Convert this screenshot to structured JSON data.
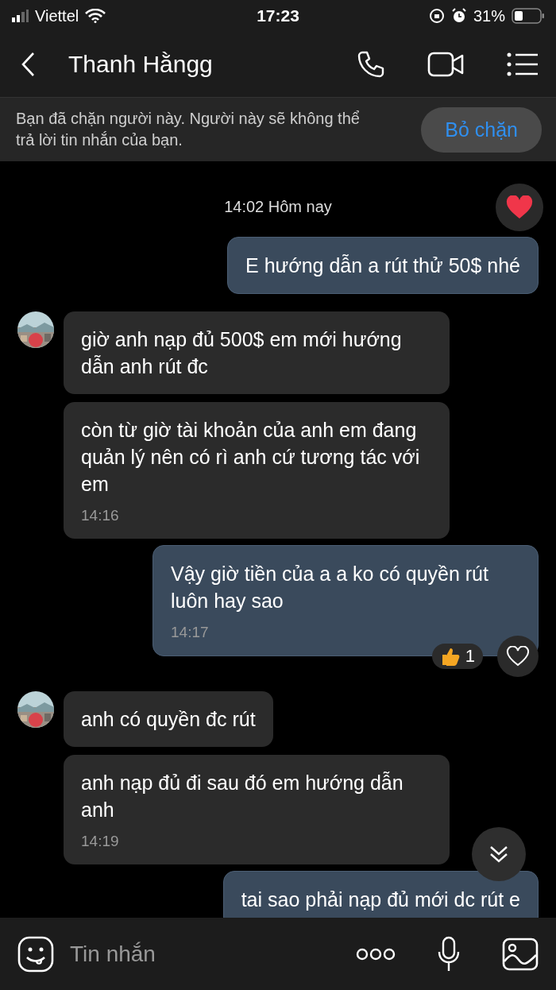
{
  "status_bar": {
    "carrier": "Viettel",
    "time": "17:23",
    "battery": "31%"
  },
  "header": {
    "title": "Thanh Hằngg"
  },
  "blocked_banner": {
    "text": "Bạn đã chặn người này. Người này sẽ không thể trả lời tin nhắn của bạn.",
    "button": "Bỏ chặn"
  },
  "date_divider": "14:02 Hôm nay",
  "messages": [
    {
      "kind": "sent",
      "text": "E hướng dẫn a rút thử 50$ nhé"
    },
    {
      "kind": "received",
      "avatar": true,
      "text": "giờ anh nạp đủ 500$ em mới hướng dẫn anh rút đc"
    },
    {
      "kind": "received",
      "avatar": false,
      "text": "còn từ giờ tài khoản của anh em đang quản lý nên có rì anh cứ tương tác với em",
      "time": "14:16"
    },
    {
      "kind": "sent",
      "text": "Vậy giờ tiền của a a ko có quyền rút luôn hay sao",
      "time": "14:17",
      "reaction_count": "1"
    },
    {
      "kind": "received",
      "avatar": true,
      "text": "anh có quyền đc rút"
    },
    {
      "kind": "received",
      "avatar": false,
      "text": "anh nạp đủ đi sau đó em hướng dẫn anh",
      "time": "14:19"
    },
    {
      "kind": "sent",
      "text": "tai sao phải nạp đủ mới dc rút e"
    }
  ],
  "composer": {
    "placeholder": "Tin nhắn"
  }
}
